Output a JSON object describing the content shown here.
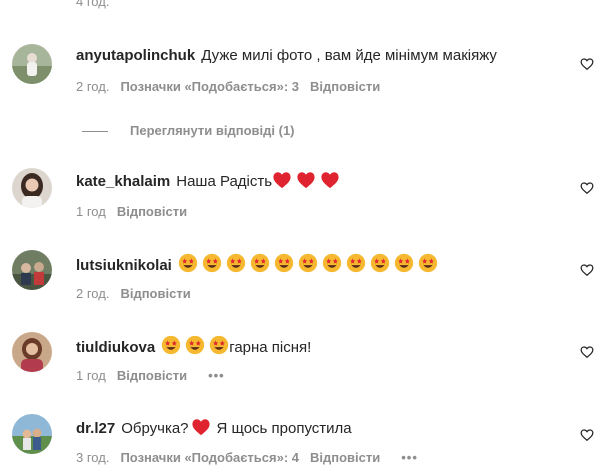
{
  "top_time": "4 год.",
  "comments": [
    {
      "username": "anyutapolinchuk",
      "text": "Дуже милі фото , вам йде мінімум макіяжу",
      "time": "2 год.",
      "likes": "Позначки «Подобається»: 3",
      "reply": "Відповісти"
    },
    {
      "username": "kate_khalaim",
      "text": "Наша Радість",
      "time": "1 год",
      "reply": "Відповісти"
    },
    {
      "username": "lutsiuknikolai",
      "time": "2 год.",
      "reply": "Відповісти"
    },
    {
      "username": "tiuldiukova",
      "text": "гарна пісня!",
      "time": "1 год",
      "reply": "Відповісти",
      "more": "•••"
    },
    {
      "username": "dr.l27",
      "text_before": "Обручка?",
      "text_after": "Я щось пропустила",
      "time": "3 год.",
      "likes": "Позначки «Подобається»: 4",
      "reply": "Відповісти",
      "more": "•••"
    }
  ],
  "view_replies": "Переглянути відповіді (1)",
  "icons": {
    "like": "heart-outline-icon",
    "love_emoji": "star-struck-emoji-icon",
    "red_heart": "red-heart-emoji-icon"
  },
  "colors": {
    "text": "#262626",
    "secondary": "#8e8e8e",
    "heart_red": "#e0242f",
    "emoji_yellow": "#f5b82e"
  }
}
